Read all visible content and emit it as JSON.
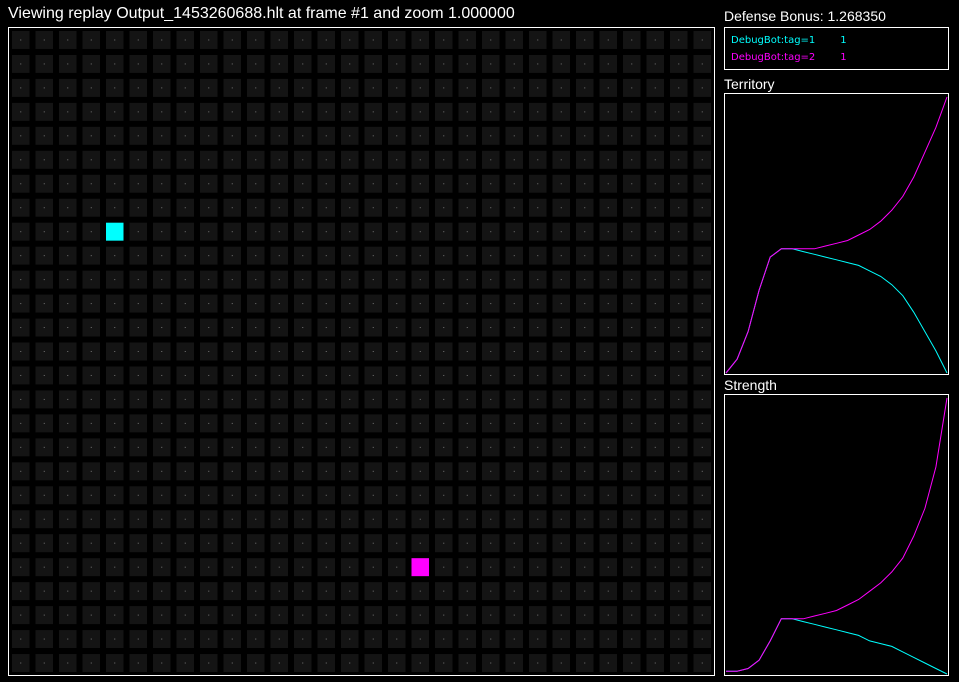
{
  "header": {
    "title": "Viewing replay Output_1453260688.hlt at frame #1 and zoom 1.000000",
    "defense_bonus": "Defense Bonus: 1.268350"
  },
  "board": {
    "grid": {
      "cols": 30,
      "rows": 27
    },
    "background_color": "#000000",
    "cell_color": "#141414",
    "dot_color": "#777777",
    "sites": [
      {
        "owner": "DebugBot:tag=1",
        "col": 4,
        "row": 8,
        "color": "#00ffff"
      },
      {
        "owner": "DebugBot:tag=2",
        "col": 17,
        "row": 22,
        "color": "#ff00ff"
      }
    ]
  },
  "legend": {
    "players": [
      {
        "name": "DebugBot:tag=1",
        "value": "1",
        "color": "#00ffff"
      },
      {
        "name": "DebugBot:tag=2",
        "value": "1",
        "color": "#ff00ff"
      }
    ]
  },
  "panels": {
    "territory_title": "Territory",
    "strength_title": "Strength"
  },
  "chart_data": [
    {
      "type": "line",
      "title": "Territory",
      "x": [
        0,
        0.05,
        0.1,
        0.15,
        0.2,
        0.25,
        0.3,
        0.35,
        0.4,
        0.45,
        0.5,
        0.55,
        0.6,
        0.65,
        0.7,
        0.75,
        0.8,
        0.85,
        0.9,
        0.95,
        1.0
      ],
      "ylim": [
        0,
        1
      ],
      "series": [
        {
          "name": "DebugBot:tag=1",
          "color": "#00ffff",
          "values": [
            0.0,
            0.05,
            0.15,
            0.3,
            0.42,
            0.45,
            0.45,
            0.44,
            0.43,
            0.42,
            0.41,
            0.4,
            0.39,
            0.37,
            0.35,
            0.32,
            0.28,
            0.22,
            0.15,
            0.08,
            0.0
          ]
        },
        {
          "name": "DebugBot:tag=2",
          "color": "#ff00ff",
          "values": [
            0.0,
            0.05,
            0.15,
            0.3,
            0.42,
            0.45,
            0.45,
            0.45,
            0.45,
            0.46,
            0.47,
            0.48,
            0.5,
            0.52,
            0.55,
            0.59,
            0.64,
            0.71,
            0.8,
            0.89,
            1.0
          ]
        }
      ]
    },
    {
      "type": "line",
      "title": "Strength",
      "x": [
        0,
        0.05,
        0.1,
        0.15,
        0.2,
        0.25,
        0.3,
        0.35,
        0.4,
        0.45,
        0.5,
        0.55,
        0.6,
        0.65,
        0.7,
        0.75,
        0.8,
        0.85,
        0.9,
        0.95,
        1.0
      ],
      "ylim": [
        0,
        1
      ],
      "series": [
        {
          "name": "DebugBot:tag=1",
          "color": "#00ffff",
          "values": [
            0.01,
            0.01,
            0.02,
            0.05,
            0.12,
            0.2,
            0.2,
            0.19,
            0.18,
            0.17,
            0.16,
            0.15,
            0.14,
            0.12,
            0.11,
            0.1,
            0.08,
            0.06,
            0.04,
            0.02,
            0.0
          ]
        },
        {
          "name": "DebugBot:tag=2",
          "color": "#ff00ff",
          "values": [
            0.01,
            0.01,
            0.02,
            0.05,
            0.12,
            0.2,
            0.2,
            0.2,
            0.21,
            0.22,
            0.23,
            0.25,
            0.27,
            0.3,
            0.33,
            0.37,
            0.42,
            0.5,
            0.6,
            0.75,
            1.0
          ]
        }
      ]
    }
  ]
}
